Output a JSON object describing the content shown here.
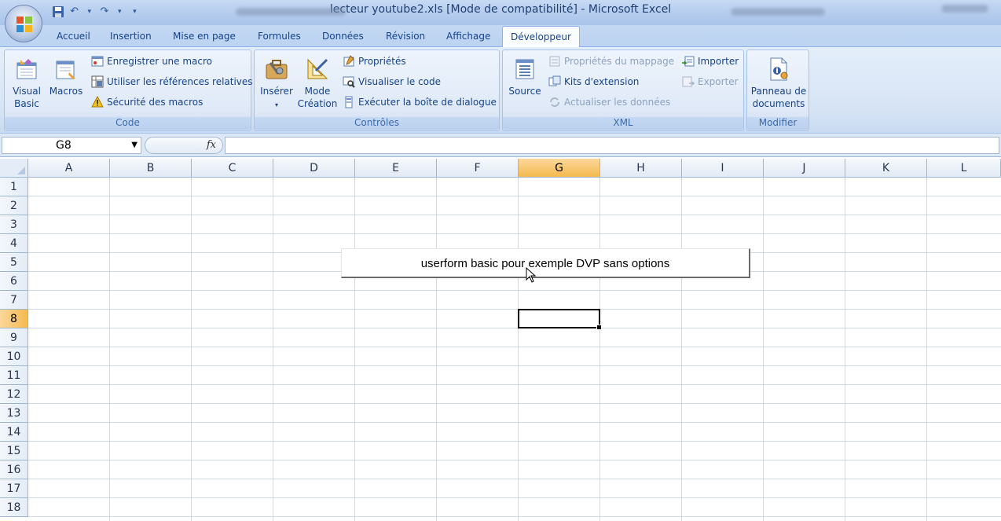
{
  "window": {
    "title": "lecteur youtube2.xls  [Mode de compatibilité] - Microsoft Excel"
  },
  "colors": {
    "accent": "#15428b",
    "selected_header": "#f5b94e"
  },
  "tabs": [
    {
      "label": "Accueil"
    },
    {
      "label": "Insertion"
    },
    {
      "label": "Mise en page"
    },
    {
      "label": "Formules"
    },
    {
      "label": "Données"
    },
    {
      "label": "Révision"
    },
    {
      "label": "Affichage"
    },
    {
      "label": "Développeur",
      "active": true
    }
  ],
  "ribbon": {
    "code": {
      "label": "Code",
      "visual_basic_line1": "Visual",
      "visual_basic_line2": "Basic",
      "macros": "Macros",
      "record_macro": "Enregistrer une macro",
      "relative_refs": "Utiliser les références relatives",
      "macro_security": "Sécurité des macros"
    },
    "controls": {
      "label": "Contrôles",
      "insert": "Insérer",
      "design_mode_line1": "Mode",
      "design_mode_line2": "Création",
      "properties": "Propriétés",
      "view_code": "Visualiser le code",
      "run_dialog": "Exécuter la boîte de dialogue"
    },
    "xml": {
      "label": "XML",
      "source": "Source",
      "map_properties": "Propriétés du mappage",
      "expansion_packs": "Kits d'extension",
      "refresh_data": "Actualiser les données",
      "import": "Importer",
      "export": "Exporter"
    },
    "modify": {
      "label": "Modifier",
      "doc_panel_line1": "Panneau de",
      "doc_panel_line2": "documents"
    }
  },
  "formula_bar": {
    "name_box": "G8",
    "fx": "fx",
    "formula": ""
  },
  "sheet": {
    "columns": [
      "A",
      "B",
      "C",
      "D",
      "E",
      "F",
      "G",
      "H",
      "I",
      "J",
      "K",
      "L"
    ],
    "rows": [
      "1",
      "2",
      "3",
      "4",
      "5",
      "6",
      "7",
      "8",
      "9",
      "10",
      "11",
      "12",
      "13",
      "14",
      "15",
      "16",
      "17",
      "18"
    ],
    "selected_column": "G",
    "selected_row": "8",
    "form_button_label": "userform basic pour exemple DVP sans options"
  }
}
